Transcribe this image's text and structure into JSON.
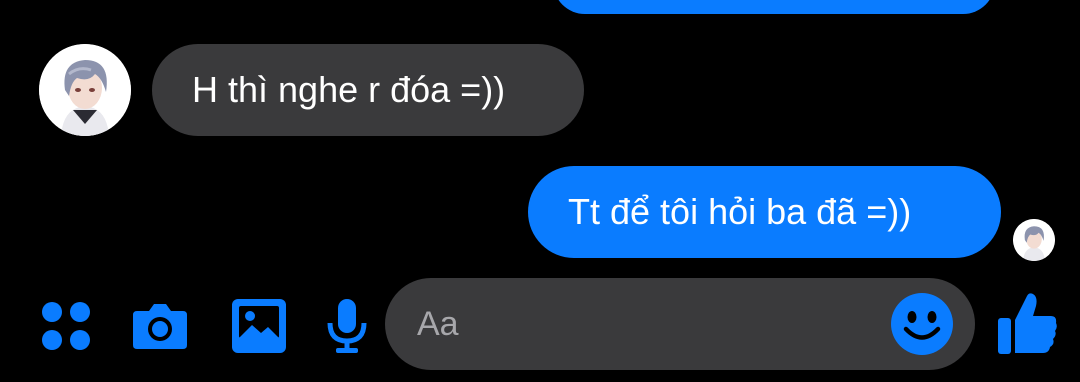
{
  "theme": {
    "accent": "#0a7cff",
    "incoming_bubble": "#3a3a3c",
    "background": "#000000"
  },
  "conversation": {
    "messages": [
      {
        "direction": "incoming",
        "text": "H thì nghe r đóa =))"
      },
      {
        "direction": "outgoing",
        "text": "Tt để tôi hỏi ba đã =))"
      }
    ]
  },
  "toolbar": {
    "icons": [
      "apps-icon",
      "camera-icon",
      "gallery-icon",
      "microphone-icon"
    ]
  },
  "composer": {
    "placeholder": "Aa",
    "emoji_icon": "smiley-icon"
  },
  "send": {
    "icon": "thumbs-up-icon"
  }
}
